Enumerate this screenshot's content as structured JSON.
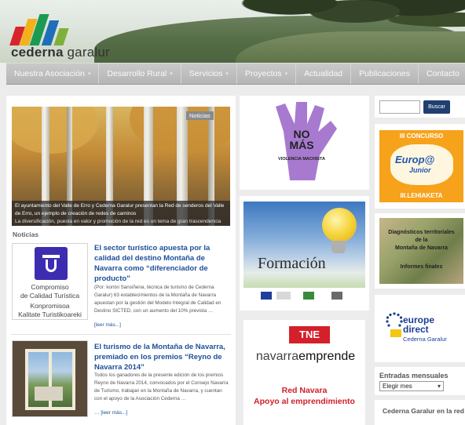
{
  "site": {
    "logo_text_bold": "cederna",
    "logo_text": " garalur",
    "logo_bar_colors": [
      "#d8242b",
      "#f3b11a",
      "#1b9a52",
      "#1e6fb8",
      "#7fb03a"
    ]
  },
  "nav": {
    "items": [
      {
        "label": "Nuestra Asociación",
        "dropdown": true
      },
      {
        "label": "Desarrollo Rural",
        "dropdown": true
      },
      {
        "label": "Servicios",
        "dropdown": true
      },
      {
        "label": "Proyectos",
        "dropdown": true
      },
      {
        "label": "Actualidad",
        "dropdown": false
      },
      {
        "label": "Publicaciones",
        "dropdown": false
      },
      {
        "label": "Contacto",
        "dropdown": false
      }
    ]
  },
  "slider": {
    "badge": "Noticias",
    "caption": "El ayuntamiento del Valle de Erro y Cederna Garalur presentan la Red de senderos del Valle de Erro, un ejemplo de creación de redes de caminos",
    "caption_line2": "La diversificación, puesta en valor y promoción de la red es un tema de gran trascendencia para el territorio"
  },
  "news_section_title": "Noticias",
  "news": [
    {
      "title": "El sector turístico apuesta por la calidad del destino Montaña de Navarra como “diferenciador de producto”",
      "text": "(Por: kontxi Sansiñena, técnica de turismo de Cederna Garalur) 63 establecimientos de la Montaña de Navarra apuestan por la gestión del Modelo Integral de Calidad en Destino SICTED, con un aumento del 10% prevista …",
      "more": "[leer más...]",
      "image_lines": [
        "Compromiso",
        "de Calidad Turística",
        "Konpromisoa",
        "Kalitate Turistikoareki"
      ]
    },
    {
      "title": "El turismo de la Montaña de Navarra, premiado en los premios “Reyno de Navarra 2014”",
      "text": "Todos los ganadores de la presente edición de los premios Reyno de Navarra 2014, convocados por el Consejo Navarra de Turismo, trabajan en la Montaña de Navarra, y cuentan con el apoyo de la Asociación Cederna …",
      "more": "[leer más...]"
    }
  ],
  "banners": {
    "nomas_line1": "NO",
    "nomas_line2": "MÁS",
    "nomas_sub": "VIOLENCIA MACHISTA",
    "formacion": "Formación",
    "tne": "TNE",
    "navarra_word": "navarra",
    "emprende_word": "emprende",
    "red_line1": "Red Navara",
    "red_line2": "Apoyo al emprendimiento"
  },
  "sidebar": {
    "search_button": "Buscar",
    "search_placeholder": "",
    "concurso_top": "III CONCURSO",
    "concurso_logo1": "Europ@",
    "concurso_logo2": "Junior",
    "concurso_bottom": "III.LEHIAKETA",
    "diag_line1": "Diagnósticos territoriales",
    "diag_line2": "de la",
    "diag_line3": "Montaña de Navarra",
    "diag_line4": "Informes finales",
    "europe_w1": "europe",
    "europe_w2": "direct",
    "europe_w3": "Cederna Garalur",
    "entradas_title": "Entradas mensuales",
    "select_value": "Elegir mes",
    "cg_title": "Cederna Garalur en la red"
  }
}
